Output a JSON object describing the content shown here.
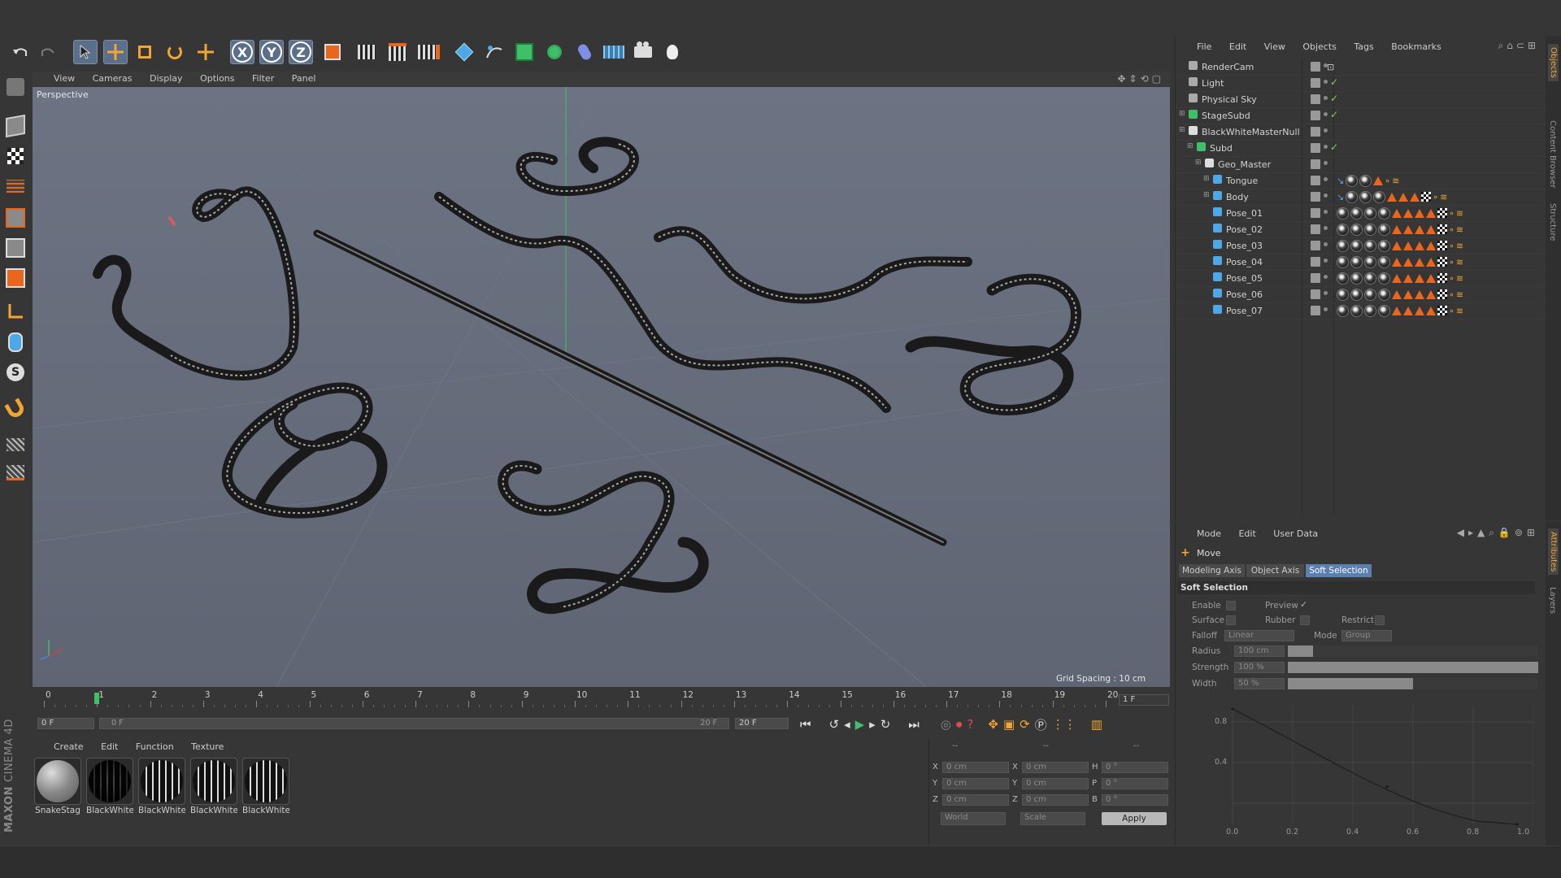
{
  "toolbar": {
    "axis_buttons": [
      "X",
      "Y",
      "Z"
    ]
  },
  "viewport": {
    "menu": [
      "View",
      "Cameras",
      "Display",
      "Options",
      "Filter",
      "Panel"
    ],
    "camera_label": "Perspective",
    "grid_spacing": "Grid Spacing : 10 cm"
  },
  "objects_panel": {
    "menu": [
      "File",
      "Edit",
      "View",
      "Objects",
      "Tags",
      "Bookmarks"
    ],
    "items": [
      {
        "name": "RenderCam",
        "indent": 0,
        "check": false
      },
      {
        "name": "Light",
        "indent": 0,
        "check": true
      },
      {
        "name": "Physical Sky",
        "indent": 0,
        "check": true
      },
      {
        "name": "StageSubd",
        "indent": 0,
        "check": true
      },
      {
        "name": "BlackWhiteMasterNull",
        "indent": 0,
        "check": false
      },
      {
        "name": "Subd",
        "indent": 1,
        "check": true
      },
      {
        "name": "Geo_Master",
        "indent": 2,
        "check": false
      },
      {
        "name": "Tongue",
        "indent": 3,
        "check": false
      },
      {
        "name": "Body",
        "indent": 3,
        "check": false
      },
      {
        "name": "Pose_01",
        "indent": 3,
        "check": false
      },
      {
        "name": "Pose_02",
        "indent": 3,
        "check": false
      },
      {
        "name": "Pose_03",
        "indent": 3,
        "check": false
      },
      {
        "name": "Pose_04",
        "indent": 3,
        "check": false
      },
      {
        "name": "Pose_05",
        "indent": 3,
        "check": false
      },
      {
        "name": "Pose_06",
        "indent": 3,
        "check": false
      },
      {
        "name": "Pose_07",
        "indent": 3,
        "check": false
      }
    ],
    "side_tabs": [
      "Objects",
      "Content Browser",
      "Structure"
    ]
  },
  "attributes_panel": {
    "menu": [
      "Mode",
      "Edit",
      "User Data"
    ],
    "tool_name": "Move",
    "tabs": [
      "Modeling Axis",
      "Object Axis",
      "Soft Selection"
    ],
    "active_tab": "Soft Selection",
    "section_title": "Soft Selection",
    "enable_label": "Enable",
    "preview_label": "Preview",
    "surface_label": "Surface",
    "rubber_label": "Rubber",
    "restrict_label": "Restrict",
    "falloff_label": "Falloff",
    "falloff_value": "Linear",
    "mode_label": "Mode",
    "mode_value": "Group",
    "radius_label": "Radius",
    "radius_value": "100 cm",
    "radius_fill": 0.1,
    "strength_label": "Strength",
    "strength_value": "100 %",
    "strength_fill": 1.0,
    "width_label": "Width",
    "width_value": "50 %",
    "width_fill": 0.5,
    "graph_y_ticks": [
      "0.8",
      "0.4"
    ],
    "graph_x_ticks": [
      "0.0",
      "0.2",
      "0.4",
      "0.6",
      "0.8",
      "1.0"
    ],
    "side_tabs": [
      "Attributes",
      "Layers"
    ]
  },
  "timeline": {
    "ticks": [
      "0",
      "1",
      "2",
      "3",
      "4",
      "5",
      "6",
      "7",
      "8",
      "9",
      "10",
      "11",
      "12",
      "13",
      "14",
      "15",
      "16",
      "17",
      "18",
      "19",
      "20"
    ],
    "current_frame_display": "1 F",
    "start_field": "0 F",
    "range_start": "0 F",
    "range_end": "20 F",
    "end_field": "20 F"
  },
  "material_manager": {
    "menu": [
      "Create",
      "Edit",
      "Function",
      "Texture"
    ],
    "materials": [
      "SnakeStag",
      "BlackWhite",
      "BlackWhite",
      "BlackWhite",
      "BlackWhite"
    ]
  },
  "coordinates": {
    "header": [
      "--",
      "--",
      "--"
    ],
    "rows": [
      {
        "a": "X",
        "av": "0 cm",
        "b": "X",
        "bv": "0 cm",
        "c": "H",
        "cv": "0 °"
      },
      {
        "a": "Y",
        "av": "0 cm",
        "b": "Y",
        "bv": "0 cm",
        "c": "P",
        "cv": "0 °"
      },
      {
        "a": "Z",
        "av": "0 cm",
        "b": "Z",
        "bv": "0 cm",
        "c": "B",
        "cv": "0 °"
      }
    ],
    "world_select": "World",
    "scale_select": "Scale",
    "apply_label": "Apply"
  },
  "branding": {
    "logo": "MAXON CINEMA 4D"
  }
}
